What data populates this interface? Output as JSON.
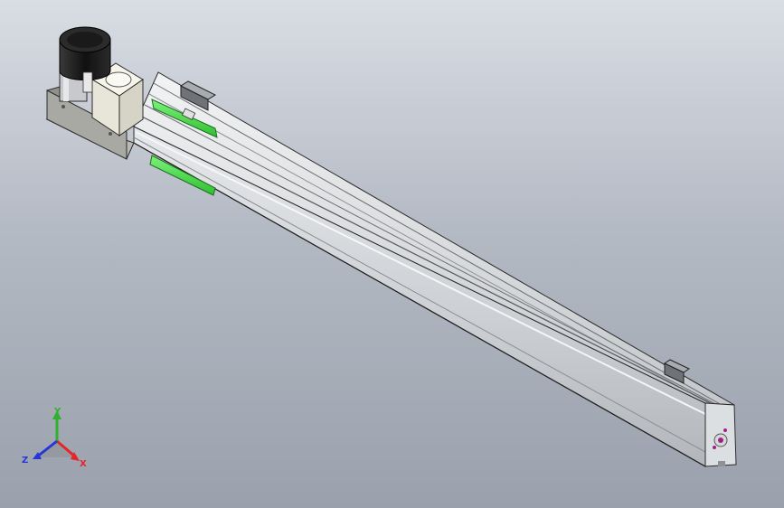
{
  "viewport": {
    "background_top": "#d9dde4",
    "background_bottom": "#9aa1ac"
  },
  "model": {
    "name_icon": "linear-actuator-module",
    "body_color": "#c9ccd1",
    "body_highlight": "#eceef0",
    "motor_color": "#1a1a1a",
    "coupling_color": "#f0eee2",
    "bracket_color": "#a7a9a2",
    "sensor_color": "#47e247",
    "end_cap_color": "#dcdfe2",
    "end_cap_accent": "#a0208a"
  },
  "triad": {
    "x_label": "X",
    "y_label": "Y",
    "z_label": "Z",
    "x_color": "#e3262b",
    "y_color": "#2fb12f",
    "z_color": "#2636d8"
  }
}
